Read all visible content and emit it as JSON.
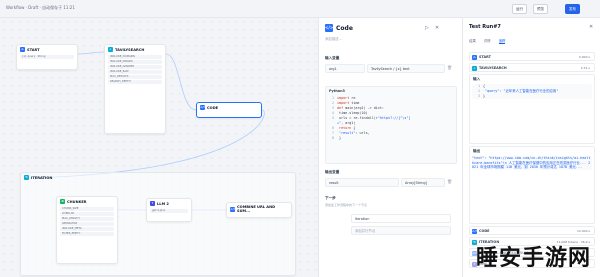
{
  "topbar": {
    "breadcrumb": "Workflow · Draft · 自动保存于 11:21",
    "buttons": [
      "运行",
      "预览",
      "发布"
    ]
  },
  "nodes": {
    "start": {
      "title": "START",
      "fields": [
        "{x} query",
        "String"
      ]
    },
    "tavily": {
      "title": "TAVILYSEARCH",
      "fields": [
        "INCLUDE_DOMAINS",
        "INCLUDE_IMAGES",
        "INCLUDE_ANSWER",
        "INCLUDE_RAW",
        "MAX_RESULTS",
        "SEARCH_DEPTH"
      ]
    },
    "code": {
      "title": "CODE"
    },
    "iteration": {
      "title": "ITERATION"
    },
    "chunker": {
      "title": "CHUNKER",
      "fields": [
        "CHUNK_SIZE",
        "OVERLAP",
        "MAX_LENGTH",
        "SEPARATOR",
        "INCLUDE_META",
        "FILTER_EMPTY"
      ]
    },
    "llm": {
      "title": "LLM 2",
      "fields": [
        "gpt-4-plus"
      ]
    },
    "combine": {
      "title": "COMBINE URL AND SUM..."
    }
  },
  "code_panel": {
    "title": "Code",
    "desc": "添加描述...",
    "input_label": "输入变量",
    "input_var": "arg1",
    "input_src": "TavilySearch / {x} text",
    "lang": "Python3",
    "code_lines": [
      "import re",
      "import time",
      "def main(arg1) -> dict:",
      "    time.sleep(10)",
      "    urls = re.findall(r\"https?://[^\\s\"]",
      "+\", arg1)",
      "    return {",
      "        \"result\": urls,",
      "    }"
    ],
    "output_label": "输出变量",
    "output_var": "result",
    "output_type": "Array[String]",
    "next_label": "下一步",
    "next_desc": "添加此工作流程中的下一个节点",
    "next_node": "Iteration",
    "next_add": "添加并行节点"
  },
  "run_panel": {
    "title": "Test Run#7",
    "tabs": [
      "结果",
      "详情",
      "追踪"
    ],
    "active_tab": "追踪",
    "steps": [
      {
        "name": "START",
        "meta": "0.000 s"
      },
      {
        "name": "TAVILYSEARCH",
        "meta": "2.31 s"
      }
    ],
    "input_label": "输入",
    "input_lines": [
      "{",
      "  \"query\": \"近年来人工智能在医疗行业的应用\"",
      "}"
    ],
    "output_label": "输出",
    "output_text": "\"text\": \"https://www.ibm.com/cn-zh/think/insights/ai-healthcare-benefits\"\\n 人工智能在医疗保健中的应用正在改变医疗行业... 2021 年全球市场规模 11B 美元，到 2030 年预计将达 187B 美元...",
    "more_steps": [
      {
        "name": "CODE",
        "meta": "12.000 s"
      },
      {
        "name": "ITERATION",
        "meta": "11.008 tokens · 36.2 s"
      },
      {
        "name": "SPLIT URL AND TEXT SUMMARY",
        "meta": ""
      },
      {
        "name": "LLM 3",
        "meta": ""
      }
    ]
  },
  "watermark": "睡安手游网"
}
